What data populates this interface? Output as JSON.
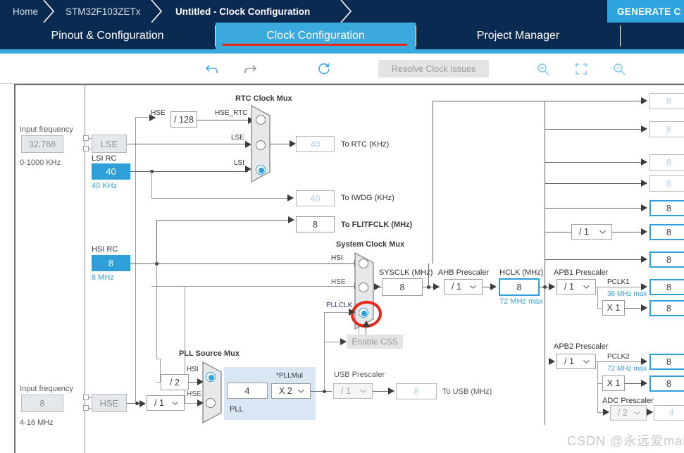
{
  "breadcrumb": {
    "items": [
      "Home",
      "STM32F103ZETx",
      "Untitled - Clock Configuration"
    ],
    "generate_label": "GENERATE C"
  },
  "tabs": [
    {
      "label": "Pinout & Configuration",
      "selected": false
    },
    {
      "label": "Clock Configuration",
      "selected": true
    },
    {
      "label": "Project Manager",
      "selected": false
    }
  ],
  "toolbar": {
    "undo_icon": "undo-icon",
    "redo_icon": "redo-icon",
    "reset_icon": "reset-icon",
    "resolve_label": "Resolve Clock Issues",
    "zoom_in_icon": "zoom-in-icon",
    "fit_icon": "fit-to-screen-icon",
    "zoom_out_icon": "zoom-out-icon"
  },
  "lse": {
    "input_freq_label": "Input frequency",
    "input_freq_value": "32.768",
    "range": "0-1000 KHz",
    "name": "LSE"
  },
  "lsi": {
    "title": "LSI RC",
    "value": "40",
    "unit": "40 KHz"
  },
  "hse": {
    "input_freq_label": "Input frequency",
    "input_freq_value": "8",
    "range": "4-16 MHz",
    "name": "HSE",
    "divider": "/ 1"
  },
  "hsi": {
    "title": "HSI RC",
    "value": "8",
    "unit": "8 MHz"
  },
  "rtc_mux": {
    "title": "RTC Clock Mux",
    "hse_label": "HSE",
    "hse_div": "/ 128",
    "inputs": [
      "HSE_RTC",
      "LSE",
      "LSI"
    ],
    "selected_index": 2
  },
  "outputs": {
    "to_rtc_value": "40",
    "to_rtc_label": "To RTC (KHz)",
    "to_iwdg_value": "40",
    "to_iwdg_label": "To IWDG (KHz)",
    "to_flitfclk_value": "8",
    "to_flitfclk_label": "To FLITFCLK (MHz)",
    "to_usb_value": "8",
    "to_usb_label": "To USB (MHz)"
  },
  "sys_mux": {
    "title": "System Clock Mux",
    "inputs": [
      "HSI",
      "HSE",
      "PLLCLK"
    ],
    "selected_index": 2,
    "enable_css": "Enable CSS"
  },
  "sysclk": {
    "label": "SYSCLK (MHz)",
    "value": "8"
  },
  "ahb_prescaler": {
    "label": "AHB Prescaler",
    "value": "/ 1"
  },
  "hclk": {
    "label": "HCLK (MHz)",
    "value": "8",
    "max": "72 MHz max"
  },
  "apb1": {
    "label": "APB1 Prescaler",
    "value": "/ 1",
    "pclk_label": "PCLK1",
    "max": "36 MHz max",
    "timer_mult": "X 1"
  },
  "apb2": {
    "label": "APB2 Prescaler",
    "value": "/ 1",
    "pclk_label": "PCLK2",
    "max": "72 MHz max",
    "timer_mult": "X 1"
  },
  "adc_prescaler": {
    "label": "ADC Prescaler",
    "value": "/ 2",
    "out_value": "4"
  },
  "pll": {
    "source_mux_title": "PLL Source Mux",
    "hsi_label": "HSI",
    "hse_label": "HSE",
    "hsi_div": "/ 2",
    "selected_index": 0,
    "panel_label": "PLL",
    "pll_value": "4",
    "pllmul_label": "*PLLMul",
    "pllmul_value": "X 2"
  },
  "usb_prescaler": {
    "label": "USB Prescaler",
    "value": "/ 1"
  },
  "right_column": {
    "disabled_values": [
      "8",
      "8",
      "8",
      "8"
    ],
    "enabled_values": [
      "8",
      "8",
      "8",
      "8",
      "8"
    ],
    "mid_prescaler": "/ 1"
  },
  "watermark": "CSDN @永远爱mai",
  "colors": {
    "navy": "#0b2a52",
    "accent": "#3aa9dd",
    "annotation_red": "#e8271a",
    "cyan_fill": "#2e9fd8"
  }
}
